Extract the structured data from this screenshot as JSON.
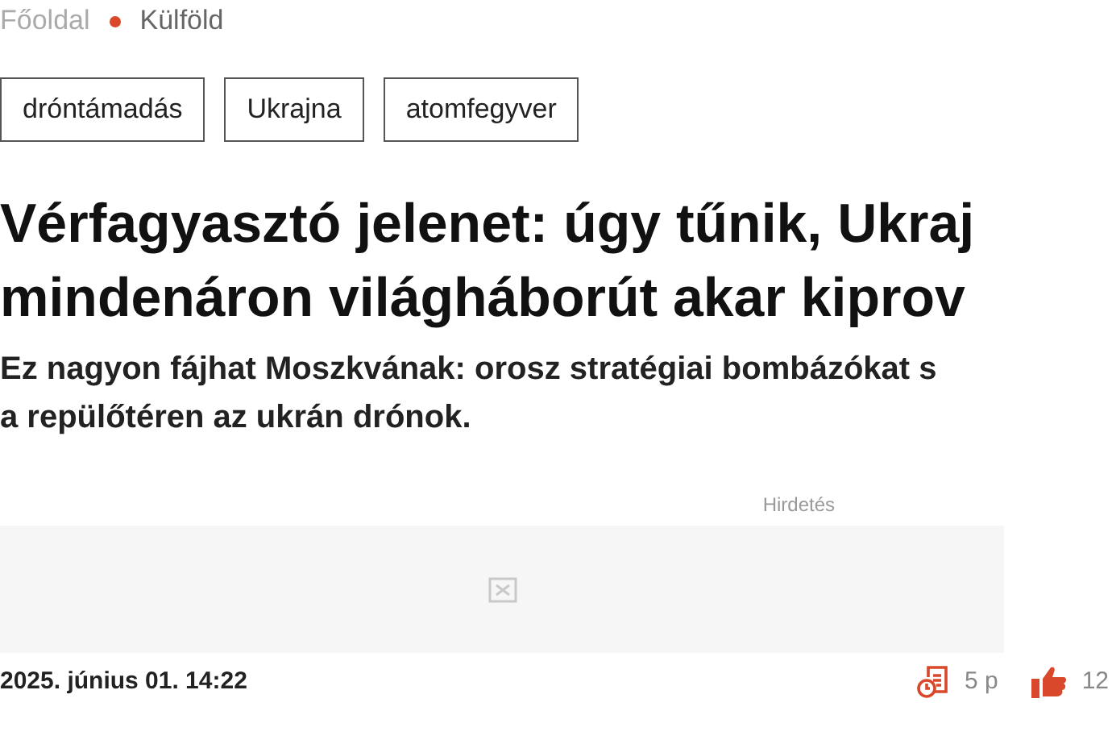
{
  "breadcrumb": [
    {
      "label": "Főoldal",
      "selected": false
    },
    {
      "label": "Külföld",
      "selected": true
    }
  ],
  "tags": [
    "dróntámadás",
    "Ukrajna",
    "atomfegyver"
  ],
  "headline_lines": [
    "Vérfagyasztó jelenet: úgy tűnik, Ukraj",
    "mindenáron világháborút akar kiprov"
  ],
  "lead_lines": [
    "Ez nagyon fájhat Moszkvának: orosz stratégiai bombázókat s",
    "a repülőtéren az ukrán drónok."
  ],
  "ad": {
    "label": "Hirdetés"
  },
  "footer": {
    "date": "2025. június 01. 14:22",
    "reading_time": "5 p",
    "likes": "12"
  }
}
